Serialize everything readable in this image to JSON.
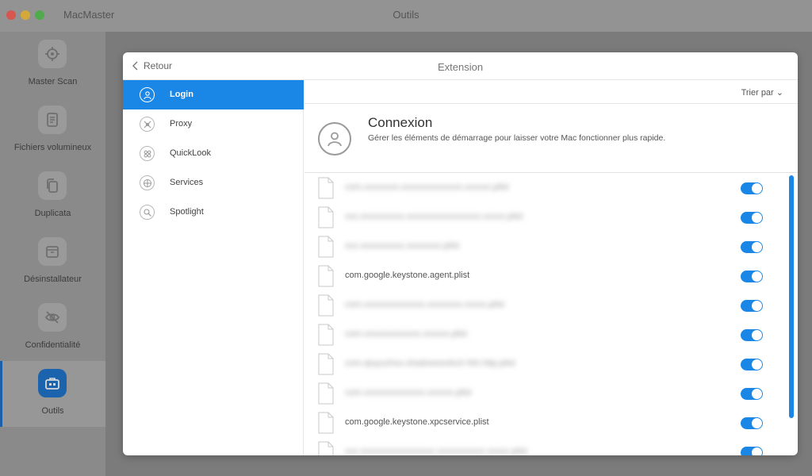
{
  "window": {
    "app_name": "MacMaster",
    "title": "Outils"
  },
  "sidebar": {
    "items": [
      {
        "label": "Master Scan",
        "icon": "target-icon",
        "active": false
      },
      {
        "label": "Fichiers volumineux",
        "icon": "document-icon",
        "active": false
      },
      {
        "label": "Duplicata",
        "icon": "copy-icon",
        "active": false
      },
      {
        "label": "Désinstallateur",
        "icon": "package-icon",
        "active": false
      },
      {
        "label": "Confidentialité",
        "icon": "eye-off-icon",
        "active": false
      },
      {
        "label": "Outils",
        "icon": "toolbox-icon",
        "active": true
      }
    ]
  },
  "panel": {
    "back_label": "Retour",
    "title": "Extension",
    "nav": [
      {
        "label": "Login",
        "icon": "user-icon",
        "active": true
      },
      {
        "label": "Proxy",
        "icon": "proxy-icon",
        "active": false
      },
      {
        "label": "QuickLook",
        "icon": "quicklook-icon",
        "active": false
      },
      {
        "label": "Services",
        "icon": "services-icon",
        "active": false
      },
      {
        "label": "Spotlight",
        "icon": "search-icon",
        "active": false
      }
    ],
    "sort_label": "Trier par ⌄",
    "header": {
      "title": "Connexion",
      "description": "Gérer les éléments de démarrage pour laisser votre Mac fonctionner plus rapide."
    },
    "items": [
      {
        "name": "com.xxxxxxxx.xxxxxxxxxxxxxx.xxxxxx.plist",
        "blurred": true,
        "enabled": true
      },
      {
        "name": "xxx.xxxxxxxxxx.xxxxxxxxxxxxxxxxx.xxxxx.plist",
        "blurred": true,
        "enabled": true
      },
      {
        "name": "xxx.xxxxxxxxxx.xxxxxxxx.plist",
        "blurred": true,
        "enabled": true
      },
      {
        "name": "com.google.keystone.agent.plist",
        "blurred": false,
        "enabled": true
      },
      {
        "name": "com.xxxxxxxxxxxxxx.xxxxxxxx.xxxxx.plist",
        "blurred": true,
        "enabled": true
      },
      {
        "name": "com.xxxxxxxxxxxxx.xxxxxx.plist",
        "blurred": true,
        "enabled": true
      },
      {
        "name": "com.qiuyuzhou.shadowsocksX-NG.http.plist",
        "blurred": true,
        "enabled": true
      },
      {
        "name": "com.xxxxxxxxxxxxxx.xxxxxx.plist",
        "blurred": true,
        "enabled": true
      },
      {
        "name": "com.google.keystone.xpcservice.plist",
        "blurred": false,
        "enabled": true
      },
      {
        "name": "xxx.xxxxxxxxxxxxxxxxx.xxxxxxxxxxx.xxxxx.plist",
        "blurred": true,
        "enabled": true
      }
    ]
  }
}
